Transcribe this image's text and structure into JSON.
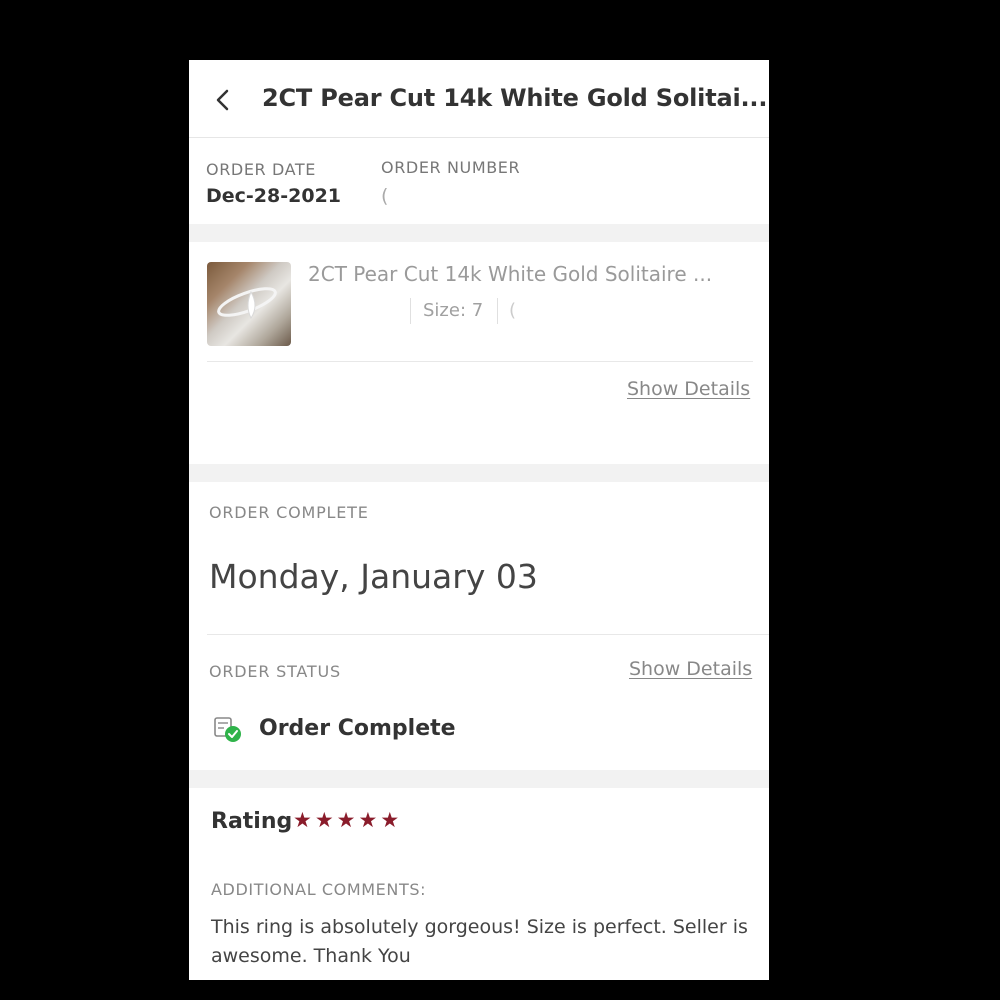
{
  "header": {
    "title": "2CT Pear Cut 14k White Gold Solitai..."
  },
  "order": {
    "date_label": "ORDER DATE",
    "date_value": "Dec-28-2021",
    "number_label": "ORDER NUMBER",
    "number_value": "("
  },
  "item": {
    "title": "2CT Pear Cut 14k White Gold Solitaire ...",
    "size": "Size: 7",
    "extra": "(",
    "show_details": "Show Details"
  },
  "completion": {
    "label": "ORDER COMPLETE",
    "date": "Monday, January 03"
  },
  "status": {
    "label": "ORDER STATUS",
    "show_details": "Show Details",
    "text": "Order Complete",
    "icon": "order-complete-icon",
    "icon_color": "#2fb34a"
  },
  "review": {
    "rating_label": "Rating",
    "stars": 5,
    "star_color": "#8a1c2b",
    "comments_label": "ADDITIONAL COMMENTS:",
    "comments": "This ring is absolutely gorgeous! Size is perfect. Seller is awesome. Thank You"
  }
}
